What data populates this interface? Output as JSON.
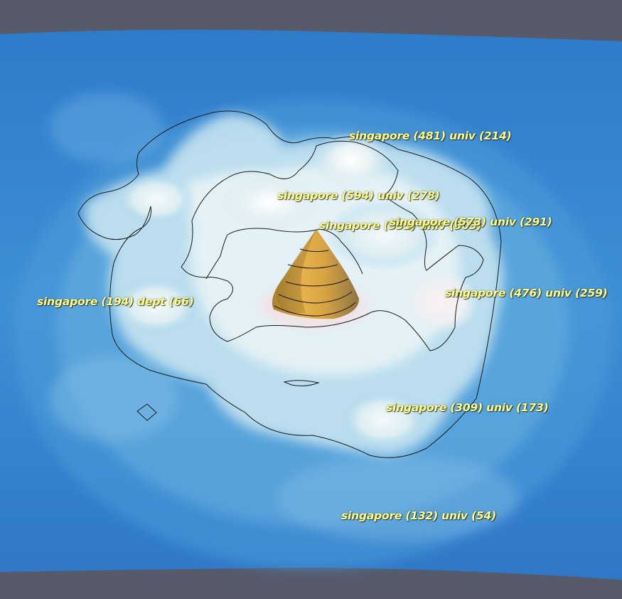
{
  "colors": {
    "background": "#565a6b",
    "ocean_deep": "#2a6fbf",
    "ocean_light": "#6ab4e6",
    "plateau": "#e9f3f5",
    "peak_gold": "#e3a93f",
    "label": "#ffff8c",
    "contour": "#1a1a1a"
  },
  "peaks": [
    {
      "id": "peak-481",
      "label": "singapore (481) univ (214)"
    },
    {
      "id": "peak-594",
      "label": "singapore (594) univ (278)"
    },
    {
      "id": "peak-551",
      "label": "singapore (551) univ (303)"
    },
    {
      "id": "peak-573",
      "label": "singapore (573) univ (291)"
    },
    {
      "id": "peak-476",
      "label": "singapore (476) univ (259)"
    },
    {
      "id": "peak-194",
      "label": "singapore (194) dept (66)"
    },
    {
      "id": "peak-309",
      "label": "singapore (309) univ (173)"
    },
    {
      "id": "peak-132",
      "label": "singapore (132) univ (54)"
    }
  ]
}
